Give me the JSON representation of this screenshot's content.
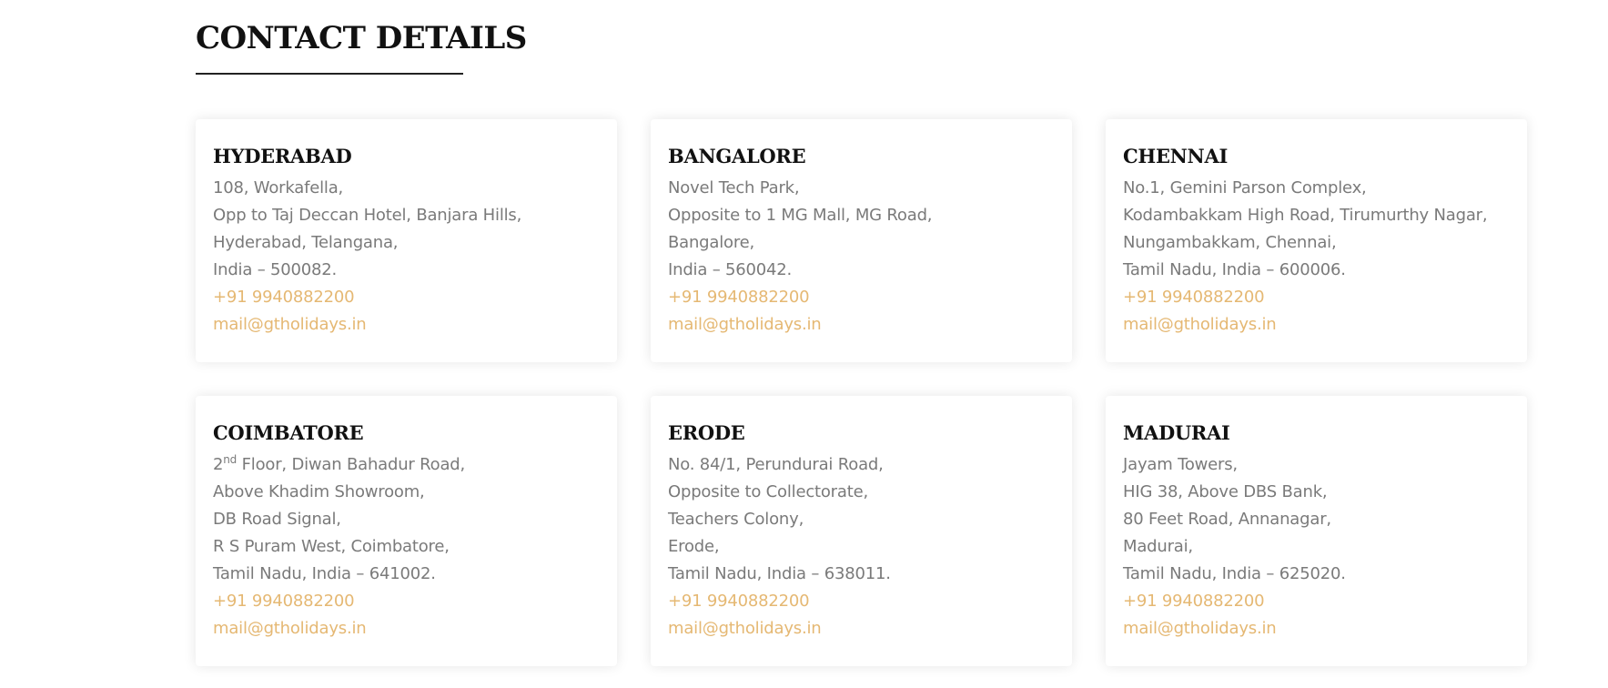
{
  "header": {
    "title": "CONTACT DETAILS"
  },
  "colors": {
    "title": "#111111",
    "body_text": "#7a7a7a",
    "accent_link": "#e5b873",
    "underline": "#222222",
    "card_bg": "#ffffff"
  },
  "offices": [
    {
      "city": "HYDERABAD",
      "address": [
        "108, Workafella,",
        "Opp to Taj Deccan Hotel, Banjara Hills,",
        "Hyderabad, Telangana,",
        "India – 500082."
      ],
      "phone": "+91 9940882200",
      "email": "mail@gtholidays.in"
    },
    {
      "city": "BANGALORE",
      "address": [
        "Novel Tech Park,",
        "Opposite to 1 MG Mall, MG Road,",
        "Bangalore,",
        "India – 560042."
      ],
      "phone": "+91 9940882200",
      "email": "mail@gtholidays.in"
    },
    {
      "city": "CHENNAI",
      "address": [
        "No.1, Gemini Parson Complex,",
        "Kodambakkam High Road, Tirumurthy Nagar,",
        "Nungambakkam, Chennai,",
        "Tamil Nadu, India – 600006."
      ],
      "phone": "+91 9940882200",
      "email": "mail@gtholidays.in"
    },
    {
      "city": "COIMBATORE",
      "floor_number": "2",
      "floor_suffix": "nd",
      "floor_rest": " Floor, Diwan Bahadur Road,",
      "address": [
        "Above Khadim Showroom,",
        "DB Road Signal,",
        "R S Puram West, Coimbatore,",
        "Tamil Nadu, India – 641002."
      ],
      "phone": "+91 9940882200",
      "email": "mail@gtholidays.in"
    },
    {
      "city": "ERODE",
      "address": [
        "No. 84/1, Perundurai Road,",
        "Opposite to Collectorate,",
        "Teachers Colony,",
        "Erode,",
        "Tamil Nadu, India – 638011."
      ],
      "phone": "+91 9940882200",
      "email": "mail@gtholidays.in"
    },
    {
      "city": "MADURAI",
      "address": [
        "Jayam Towers,",
        "HIG 38, Above DBS Bank,",
        "80 Feet Road, Annanagar,",
        "Madurai,",
        "Tamil Nadu, India – 625020."
      ],
      "phone": "+91 9940882200",
      "email": "mail@gtholidays.in"
    }
  ]
}
